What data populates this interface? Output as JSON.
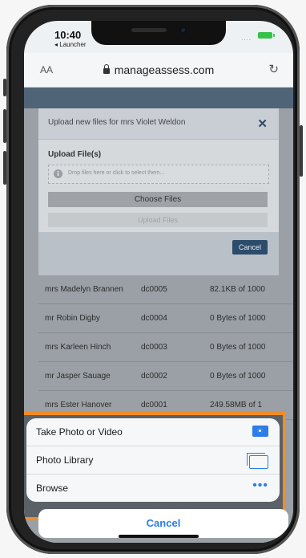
{
  "status": {
    "time": "10:40",
    "back_app": "◂ Launcher",
    "signal": "....",
    "battery_color": "#36c24a"
  },
  "browser": {
    "text_size": "AA",
    "url": "manageassess.com",
    "reload_icon": "reload-icon"
  },
  "modal": {
    "title": "Upload new files for mrs Violet Weldon",
    "close_icon": "close-icon",
    "upload_label": "Upload File(s)",
    "dropzone_text": "Drop files here or click to select them...",
    "choose_files": "Choose Files",
    "upload_files": "Upload Files",
    "cancel": "Cancel"
  },
  "table": {
    "rows": [
      {
        "name": "mrs Madelyn Brannen",
        "code": "dc0005",
        "size": "82.1KB of 1000"
      },
      {
        "name": "mr Robin Digby",
        "code": "dc0004",
        "size": "0 Bytes of 1000"
      },
      {
        "name": "mrs Karleen Hinch",
        "code": "dc0003",
        "size": "0 Bytes of 1000"
      },
      {
        "name": "mr Jasper Sauage",
        "code": "dc0002",
        "size": "0 Bytes of 1000"
      },
      {
        "name": "mrs Ester Hanover",
        "code": "dc0001",
        "size": "249.58MB of 1"
      }
    ]
  },
  "sheet": {
    "options": [
      {
        "label": "Take Photo or Video",
        "icon": "camera-icon"
      },
      {
        "label": "Photo Library",
        "icon": "photo-library-icon"
      },
      {
        "label": "Browse",
        "icon": "more-icon"
      }
    ],
    "cancel": "Cancel",
    "highlight_color": "#f28c28",
    "accent_color": "#2b7de9"
  }
}
